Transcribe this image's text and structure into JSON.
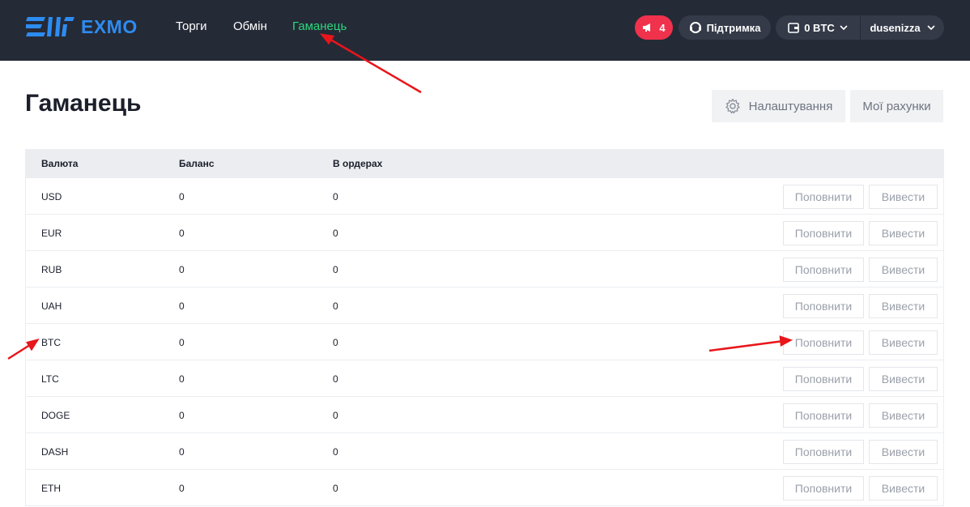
{
  "header": {
    "logo_text": "EXMO",
    "nav": {
      "trade": "Торги",
      "exchange": "Обмін",
      "wallet": "Гаманець"
    },
    "notifications_count": "4",
    "support_label": "Підтримка",
    "balance_label": "0 BTC",
    "username": "dusenizza",
    "accent_color": "#2bd67b",
    "notif_color": "#f0324d"
  },
  "page": {
    "title": "Гаманець",
    "settings_label": "Налаштування",
    "accounts_label": "Мої рахунки"
  },
  "table": {
    "headers": [
      "Валюта",
      "Баланс",
      "В ордерах"
    ],
    "deposit_label": "Поповнити",
    "withdraw_label": "Вивести",
    "rows": [
      {
        "currency": "USD",
        "balance": "0",
        "in_orders": "0"
      },
      {
        "currency": "EUR",
        "balance": "0",
        "in_orders": "0"
      },
      {
        "currency": "RUB",
        "balance": "0",
        "in_orders": "0"
      },
      {
        "currency": "UAH",
        "balance": "0",
        "in_orders": "0"
      },
      {
        "currency": "BTC",
        "balance": "0",
        "in_orders": "0"
      },
      {
        "currency": "LTC",
        "balance": "0",
        "in_orders": "0"
      },
      {
        "currency": "DOGE",
        "balance": "0",
        "in_orders": "0"
      },
      {
        "currency": "DASH",
        "balance": "0",
        "in_orders": "0"
      },
      {
        "currency": "ETH",
        "balance": "0",
        "in_orders": "0"
      }
    ]
  },
  "annotation_color": "#e8161b"
}
